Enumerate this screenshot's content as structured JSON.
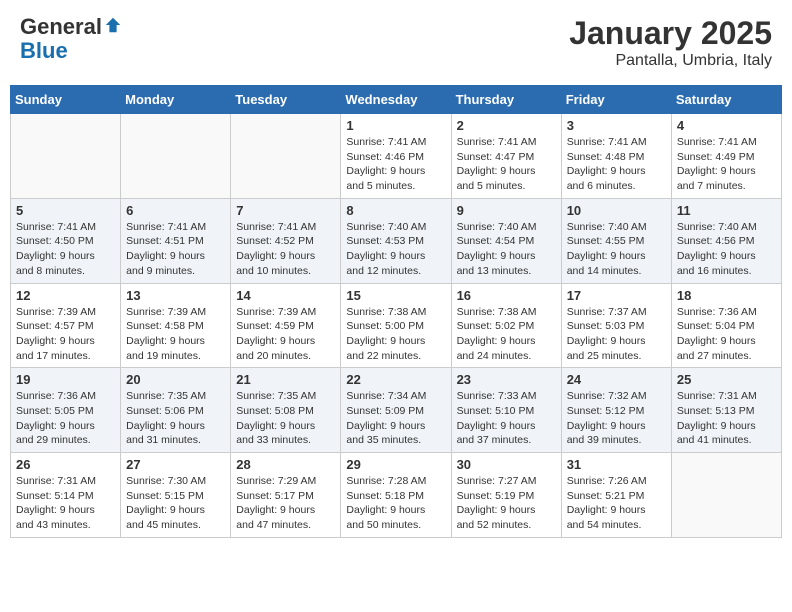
{
  "header": {
    "logo_general": "General",
    "logo_blue": "Blue",
    "title": "January 2025",
    "subtitle": "Pantalla, Umbria, Italy"
  },
  "weekdays": [
    "Sunday",
    "Monday",
    "Tuesday",
    "Wednesday",
    "Thursday",
    "Friday",
    "Saturday"
  ],
  "weeks": [
    [
      {
        "day": "",
        "info": ""
      },
      {
        "day": "",
        "info": ""
      },
      {
        "day": "",
        "info": ""
      },
      {
        "day": "1",
        "info": "Sunrise: 7:41 AM\nSunset: 4:46 PM\nDaylight: 9 hours and 5 minutes."
      },
      {
        "day": "2",
        "info": "Sunrise: 7:41 AM\nSunset: 4:47 PM\nDaylight: 9 hours and 5 minutes."
      },
      {
        "day": "3",
        "info": "Sunrise: 7:41 AM\nSunset: 4:48 PM\nDaylight: 9 hours and 6 minutes."
      },
      {
        "day": "4",
        "info": "Sunrise: 7:41 AM\nSunset: 4:49 PM\nDaylight: 9 hours and 7 minutes."
      }
    ],
    [
      {
        "day": "5",
        "info": "Sunrise: 7:41 AM\nSunset: 4:50 PM\nDaylight: 9 hours and 8 minutes."
      },
      {
        "day": "6",
        "info": "Sunrise: 7:41 AM\nSunset: 4:51 PM\nDaylight: 9 hours and 9 minutes."
      },
      {
        "day": "7",
        "info": "Sunrise: 7:41 AM\nSunset: 4:52 PM\nDaylight: 9 hours and 10 minutes."
      },
      {
        "day": "8",
        "info": "Sunrise: 7:40 AM\nSunset: 4:53 PM\nDaylight: 9 hours and 12 minutes."
      },
      {
        "day": "9",
        "info": "Sunrise: 7:40 AM\nSunset: 4:54 PM\nDaylight: 9 hours and 13 minutes."
      },
      {
        "day": "10",
        "info": "Sunrise: 7:40 AM\nSunset: 4:55 PM\nDaylight: 9 hours and 14 minutes."
      },
      {
        "day": "11",
        "info": "Sunrise: 7:40 AM\nSunset: 4:56 PM\nDaylight: 9 hours and 16 minutes."
      }
    ],
    [
      {
        "day": "12",
        "info": "Sunrise: 7:39 AM\nSunset: 4:57 PM\nDaylight: 9 hours and 17 minutes."
      },
      {
        "day": "13",
        "info": "Sunrise: 7:39 AM\nSunset: 4:58 PM\nDaylight: 9 hours and 19 minutes."
      },
      {
        "day": "14",
        "info": "Sunrise: 7:39 AM\nSunset: 4:59 PM\nDaylight: 9 hours and 20 minutes."
      },
      {
        "day": "15",
        "info": "Sunrise: 7:38 AM\nSunset: 5:00 PM\nDaylight: 9 hours and 22 minutes."
      },
      {
        "day": "16",
        "info": "Sunrise: 7:38 AM\nSunset: 5:02 PM\nDaylight: 9 hours and 24 minutes."
      },
      {
        "day": "17",
        "info": "Sunrise: 7:37 AM\nSunset: 5:03 PM\nDaylight: 9 hours and 25 minutes."
      },
      {
        "day": "18",
        "info": "Sunrise: 7:36 AM\nSunset: 5:04 PM\nDaylight: 9 hours and 27 minutes."
      }
    ],
    [
      {
        "day": "19",
        "info": "Sunrise: 7:36 AM\nSunset: 5:05 PM\nDaylight: 9 hours and 29 minutes."
      },
      {
        "day": "20",
        "info": "Sunrise: 7:35 AM\nSunset: 5:06 PM\nDaylight: 9 hours and 31 minutes."
      },
      {
        "day": "21",
        "info": "Sunrise: 7:35 AM\nSunset: 5:08 PM\nDaylight: 9 hours and 33 minutes."
      },
      {
        "day": "22",
        "info": "Sunrise: 7:34 AM\nSunset: 5:09 PM\nDaylight: 9 hours and 35 minutes."
      },
      {
        "day": "23",
        "info": "Sunrise: 7:33 AM\nSunset: 5:10 PM\nDaylight: 9 hours and 37 minutes."
      },
      {
        "day": "24",
        "info": "Sunrise: 7:32 AM\nSunset: 5:12 PM\nDaylight: 9 hours and 39 minutes."
      },
      {
        "day": "25",
        "info": "Sunrise: 7:31 AM\nSunset: 5:13 PM\nDaylight: 9 hours and 41 minutes."
      }
    ],
    [
      {
        "day": "26",
        "info": "Sunrise: 7:31 AM\nSunset: 5:14 PM\nDaylight: 9 hours and 43 minutes."
      },
      {
        "day": "27",
        "info": "Sunrise: 7:30 AM\nSunset: 5:15 PM\nDaylight: 9 hours and 45 minutes."
      },
      {
        "day": "28",
        "info": "Sunrise: 7:29 AM\nSunset: 5:17 PM\nDaylight: 9 hours and 47 minutes."
      },
      {
        "day": "29",
        "info": "Sunrise: 7:28 AM\nSunset: 5:18 PM\nDaylight: 9 hours and 50 minutes."
      },
      {
        "day": "30",
        "info": "Sunrise: 7:27 AM\nSunset: 5:19 PM\nDaylight: 9 hours and 52 minutes."
      },
      {
        "day": "31",
        "info": "Sunrise: 7:26 AM\nSunset: 5:21 PM\nDaylight: 9 hours and 54 minutes."
      },
      {
        "day": "",
        "info": ""
      }
    ]
  ]
}
